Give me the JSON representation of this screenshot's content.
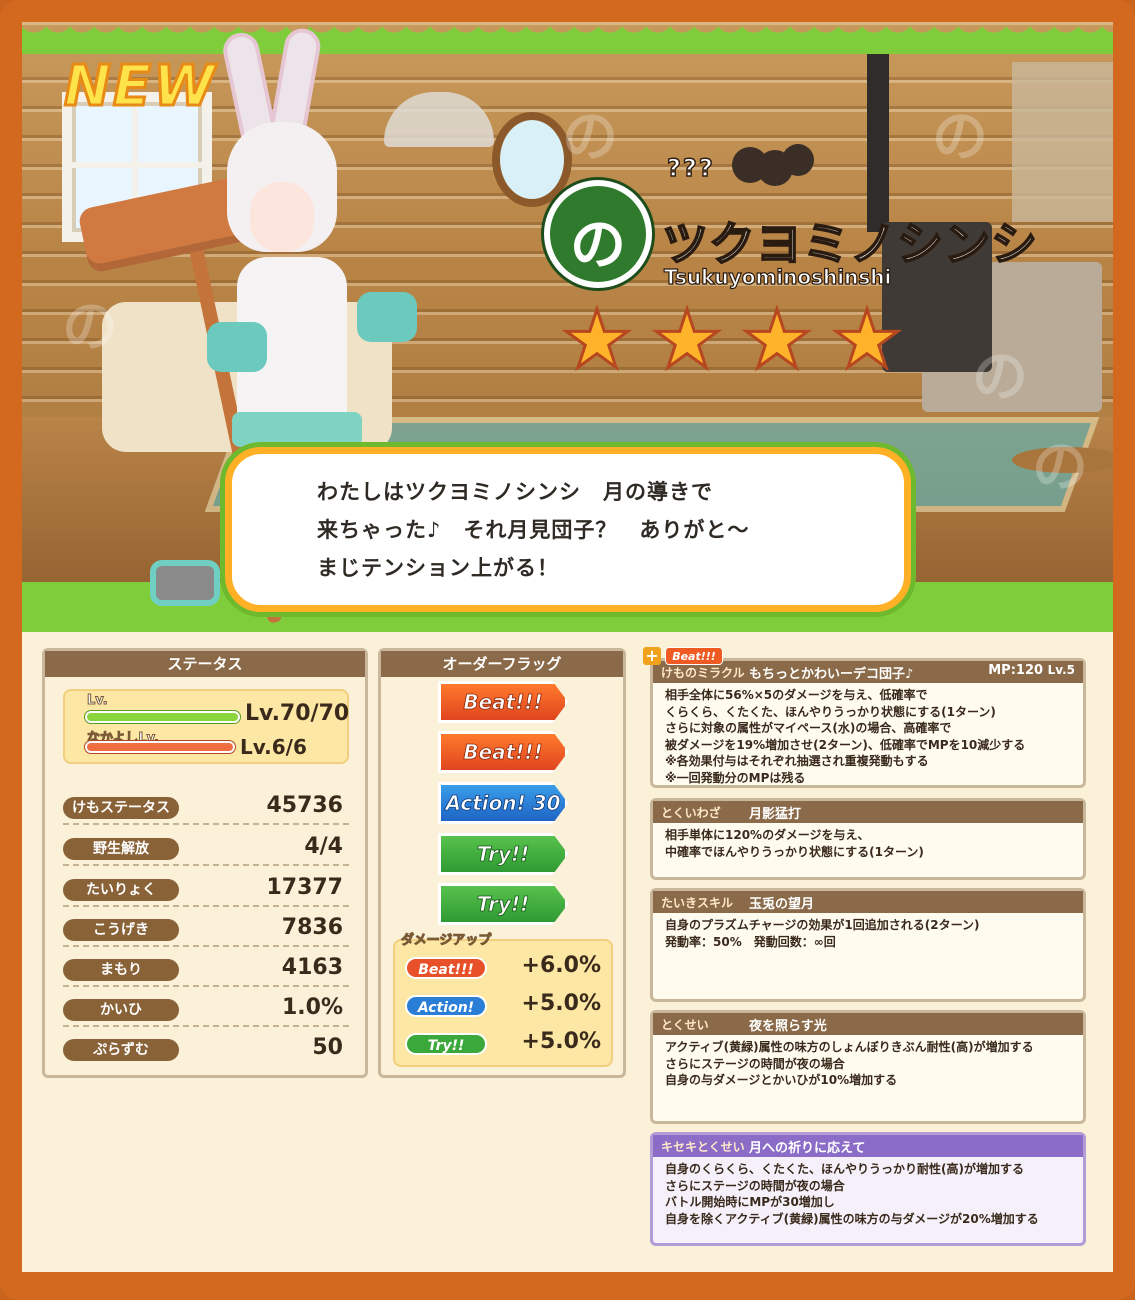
{
  "hero": {
    "new_badge": "NEW",
    "unknown_label": "???",
    "name_jp": "ツクヨミノシンシ",
    "name_en": "Tsukuyominoshinshi",
    "rarity_stars": 4,
    "star_glyph": "★",
    "logo_glyph": "の",
    "dialogue": [
      "わたしはツクヨミノシンシ　月の導きで",
      "来ちゃった♪　それ月見団子？　ありがと～",
      "まじテンション上がる！"
    ]
  },
  "status": {
    "title": "ステータス",
    "lv_label": "Lv.",
    "lv_value": "Lv.70/70",
    "lv_fraction": 1.0,
    "friend_label": "なかよしLv.",
    "friend_value": "Lv.6/6",
    "friend_fraction": 1.0,
    "rows": [
      {
        "label": "けもステータス",
        "value": "45736"
      },
      {
        "label": "野生解放",
        "value": "4/4"
      },
      {
        "label": "たいりょく",
        "value": "17377"
      },
      {
        "label": "こうげき",
        "value": "7836"
      },
      {
        "label": "まもり",
        "value": "4163"
      },
      {
        "label": "かいひ",
        "value": "1.0%"
      },
      {
        "label": "ぷらずむ",
        "value": "50"
      }
    ]
  },
  "order_flags": {
    "title": "オーダーフラッグ",
    "flags": [
      {
        "label": "Beat!!!",
        "type": "beat"
      },
      {
        "label": "Beat!!!",
        "type": "beat"
      },
      {
        "label": "Action! 30",
        "type": "action"
      },
      {
        "label": "Try!!",
        "type": "try"
      },
      {
        "label": "Try!!",
        "type": "try"
      }
    ],
    "damage_up_title": "ダメージアップ",
    "damage_up": [
      {
        "label": "Beat!!!",
        "value": "+6.0%",
        "color": "#e8502a"
      },
      {
        "label": "Action!",
        "value": "+5.0%",
        "color": "#2a7ed6"
      },
      {
        "label": "Try!!",
        "value": "+5.0%",
        "color": "#3aa83a"
      }
    ]
  },
  "skills": {
    "miracle": {
      "tag": "Beat!!!",
      "category": "けものミラクル",
      "name": "もちっとかわいーデコ団子♪",
      "mp": "MP:120",
      "level": "Lv.5",
      "text": "相手全体に56%×5のダメージを与え、低確率で\nくらくら、くたくた、ほんやりうっかり状態にする(1ターン)\nさらに対象の属性がマイペース(水)の場合、高確率で\n被ダメージを19%増加させ(2ターン)、低確率でMPを10減少する\n※各効果付与はそれぞれ抽選され重複発動もする\n※一回発動分のMPは残る"
    },
    "special": {
      "category": "とくいわざ",
      "name": "月影猛打",
      "text": "相手単体に120%のダメージを与え、\n中確率でほんやりうっかり状態にする(1ターン)"
    },
    "standby": {
      "category": "たいきスキル",
      "name": "玉兎の望月",
      "text": "自身のプラズムチャージの効果が1回追加される(2ターン)\n発動率：50%　発動回数：∞回"
    },
    "trait": {
      "category": "とくせい",
      "name": "夜を照らす光",
      "text": "アクティブ(黄緑)属性の味方のしょんぼりきぶん耐性(高)が増加する\nさらにステージの時間が夜の場合\n自身の与ダメージとかいひが10%増加する"
    },
    "kiseki": {
      "category": "キセキとくせい",
      "name": "月への祈りに応えて",
      "text": "自身のくらくら、くたくた、ほんやりうっかり耐性(高)が増加する\nさらにステージの時間が夜の場合\nバトル開始時にMPが30増加し\n自身を除くアクティブ(黄緑)属性の味方の与ダメージが20%増加する"
    }
  },
  "colors": {
    "frame": "#d2691f",
    "panel_head": "#8a6a48",
    "grass": "#7fcd3a",
    "star": "#ffb32a",
    "kiseki": "#8b6cc7"
  }
}
